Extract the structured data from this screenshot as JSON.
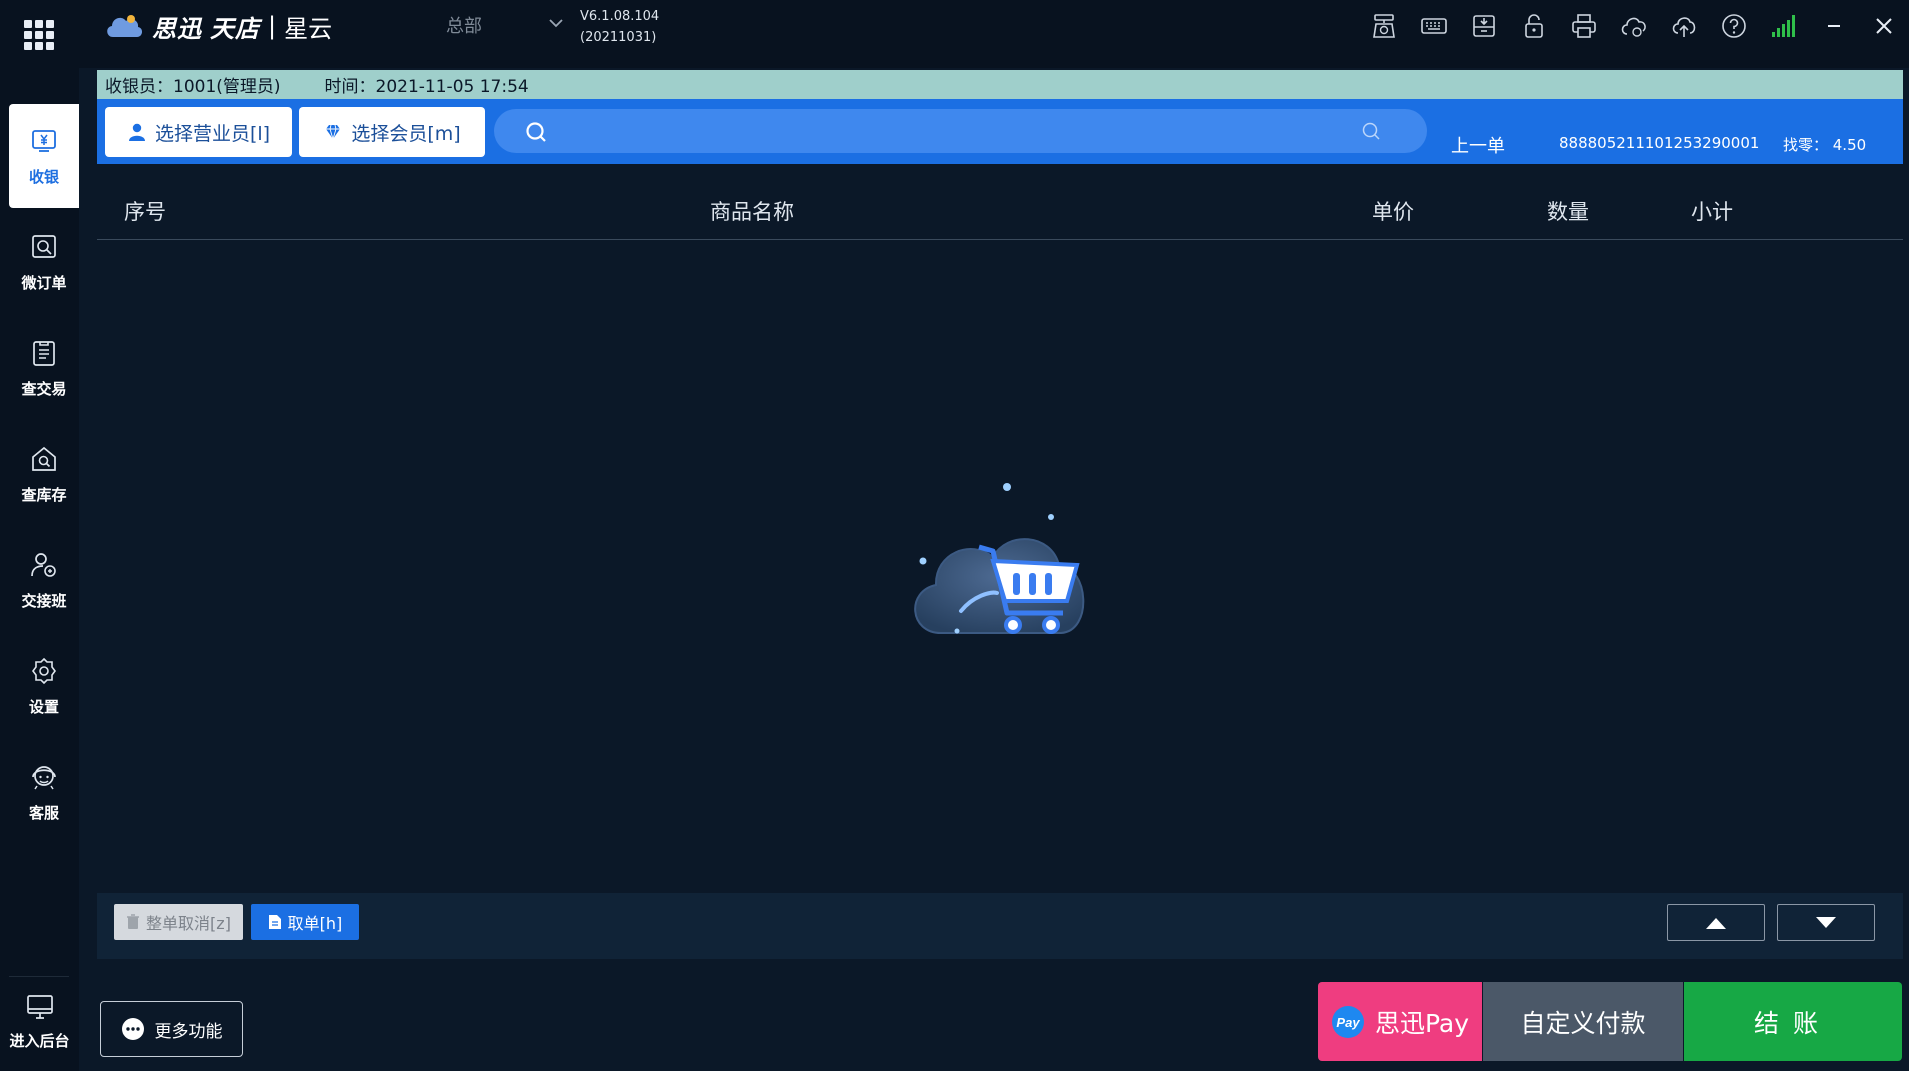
{
  "app": {
    "logo_brand": "思迅",
    "logo_product": "天店",
    "logo_separator": "|",
    "logo_suffix": "星云",
    "store": "总部",
    "version": "V6.1.08.104",
    "build": "(20211031)"
  },
  "toolbar": {
    "icons": [
      "scale-icon",
      "keyboard-icon",
      "cash-drawer-icon",
      "lock-icon",
      "printer-icon",
      "cloud-sync-icon",
      "cloud-upload-icon",
      "help-icon",
      "signal-icon",
      "minimize-icon",
      "close-icon"
    ]
  },
  "sidebar": {
    "items": [
      {
        "label": "收银",
        "icon": "cashier-icon",
        "active": true
      },
      {
        "label": "微订单",
        "icon": "micro-order-icon",
        "active": false
      },
      {
        "label": "查交易",
        "icon": "transaction-icon",
        "active": false
      },
      {
        "label": "查库存",
        "icon": "inventory-icon",
        "active": false
      },
      {
        "label": "交接班",
        "icon": "shift-handover-icon",
        "active": false
      },
      {
        "label": "设置",
        "icon": "settings-icon",
        "active": false
      },
      {
        "label": "客服",
        "icon": "support-icon",
        "active": false
      }
    ],
    "backend_label": "进入后台"
  },
  "info_bar": {
    "cashier": "收银员：1001(管理员)",
    "time": "时间：2021-11-05 17:54"
  },
  "action_bar": {
    "select_salesperson": "选择营业员[l]",
    "select_member": "选择会员[m]",
    "search_value": "",
    "prev_order_label": "上一单",
    "prev_order_no": "888805211101253290001",
    "change": "找零：  4.50"
  },
  "table": {
    "columns": [
      "序号",
      "商品名称",
      "单价",
      "数量",
      "小计"
    ],
    "rows": []
  },
  "bottom_bar": {
    "cancel_all": "整单取消[z]",
    "take_order": "取单[h]"
  },
  "footer": {
    "more_functions": "更多功能",
    "sixun_pay": "思迅Pay",
    "pay_badge": "Pay",
    "custom_payment": "自定义付款",
    "checkout": "结账"
  },
  "colors": {
    "accent_blue": "#1b6fe3",
    "info_strip": "#9fcfcb",
    "pay_pink": "#ef3d80",
    "checkout_green": "#17a845",
    "custom_gray": "#4b5868",
    "background": "#0b1828"
  }
}
